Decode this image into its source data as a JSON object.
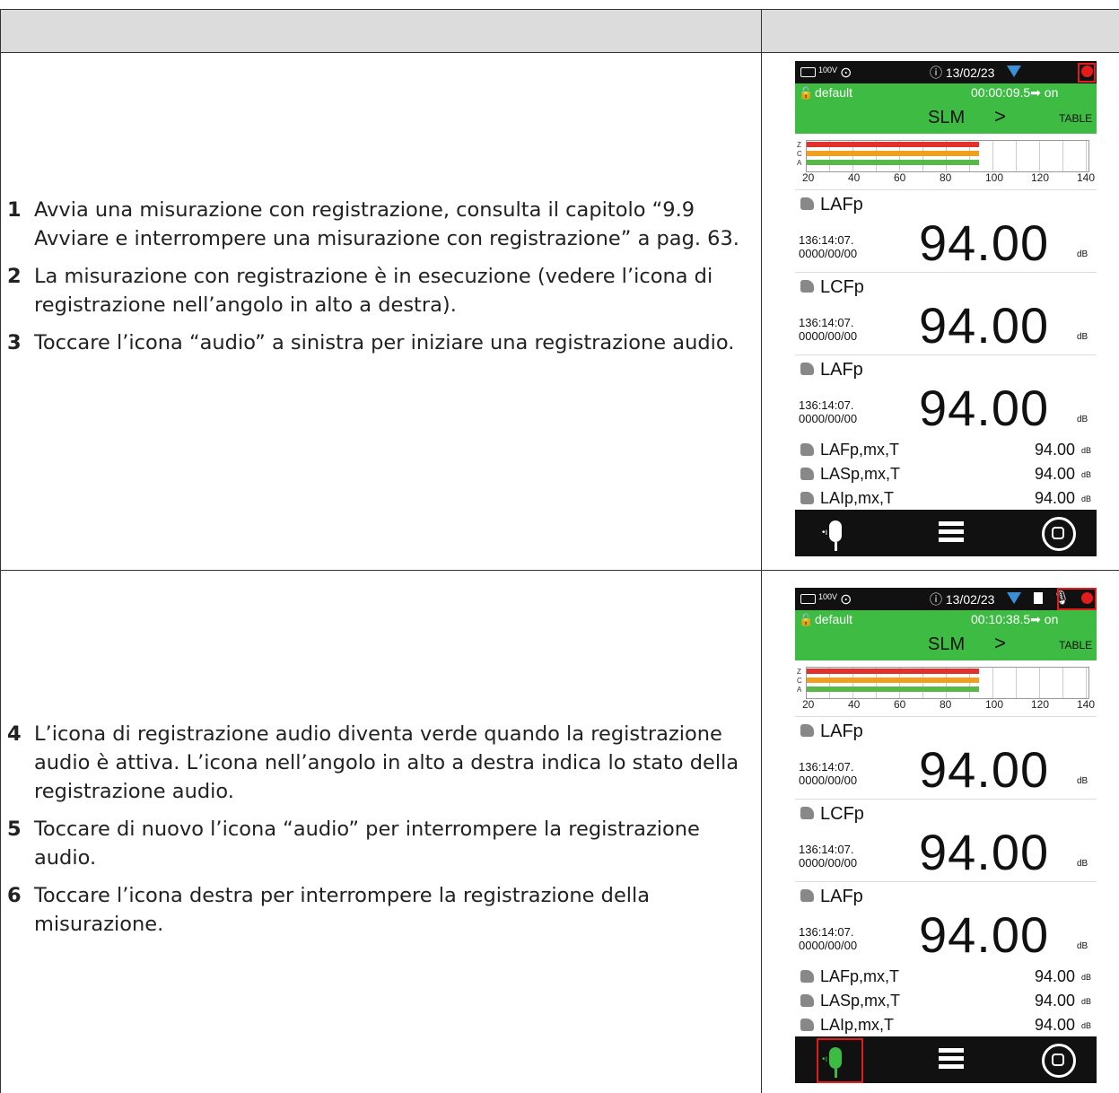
{
  "steps_top": [
    {
      "n": "1",
      "text": "Avvia una misurazione con registrazione, consulta il capitolo “9.9 Avviare e interrompere una misurazione con registrazione” a pag. 63."
    },
    {
      "n": "2",
      "text": "La misurazione con registrazione è in esecuzione (vedere l’icona di registrazione nell’angolo in alto a destra)."
    },
    {
      "n": "3",
      "text": "Toccare l’icona “audio” a sinistra per iniziare una registrazione audio."
    }
  ],
  "steps_bottom": [
    {
      "n": "4",
      "text": "L’icona di registrazione audio diventa verde quando la registrazione audio è attiva. L’icona nell’angolo in alto a destra indica lo stato della registrazione audio."
    },
    {
      "n": "5",
      "text": "Toccare di nuovo l’icona “audio” per interrompere la registrazione audio."
    },
    {
      "n": "6",
      "text": "Toccare l’icona destra per interrompere la registrazione della misurazione."
    }
  ],
  "screen1": {
    "voltage": "100V",
    "date": "13/02/23",
    "profile": "default",
    "elapsed": "00:00:09.5➡ on",
    "mode": "SLM",
    "arrow": ">",
    "view": "TABLE"
  },
  "screen2": {
    "voltage": "100V",
    "date": "13/02/23",
    "profile": "default",
    "elapsed": "00:10:38.5➡ on",
    "mode": "SLM",
    "arrow": ">",
    "view": "TABLE"
  },
  "bar_labels": [
    "Z",
    "C",
    "A"
  ],
  "scale_ticks": [
    "20",
    "40",
    "60",
    "80",
    "100",
    "120",
    "140"
  ],
  "levels": {
    "Z": 94,
    "C": 94,
    "A": 94
  },
  "measure_blocks": [
    {
      "name": "LAFp",
      "time": "136:14:07.",
      "date": "0000/00/00",
      "value": "94.00",
      "unit": "dB"
    },
    {
      "name": "LCFp",
      "time": "136:14:07.",
      "date": "0000/00/00",
      "value": "94.00",
      "unit": "dB"
    },
    {
      "name": "LAFp",
      "time": "136:14:07.",
      "date": "0000/00/00",
      "value": "94.00",
      "unit": "dB"
    }
  ],
  "small_rows": [
    {
      "name": "LAFp,mx,T",
      "value": "94.00",
      "unit": "dB"
    },
    {
      "name": "LASp,mx,T",
      "value": "94.00",
      "unit": "dB"
    },
    {
      "name": "LAIp,mx,T",
      "value": "94.00",
      "unit": "dB"
    }
  ],
  "colors": {
    "green": "#3dbb43",
    "red": "#e31b1b",
    "bar_z": "#e2312a",
    "bar_c": "#f0a01e",
    "bar_a": "#59b84a"
  }
}
